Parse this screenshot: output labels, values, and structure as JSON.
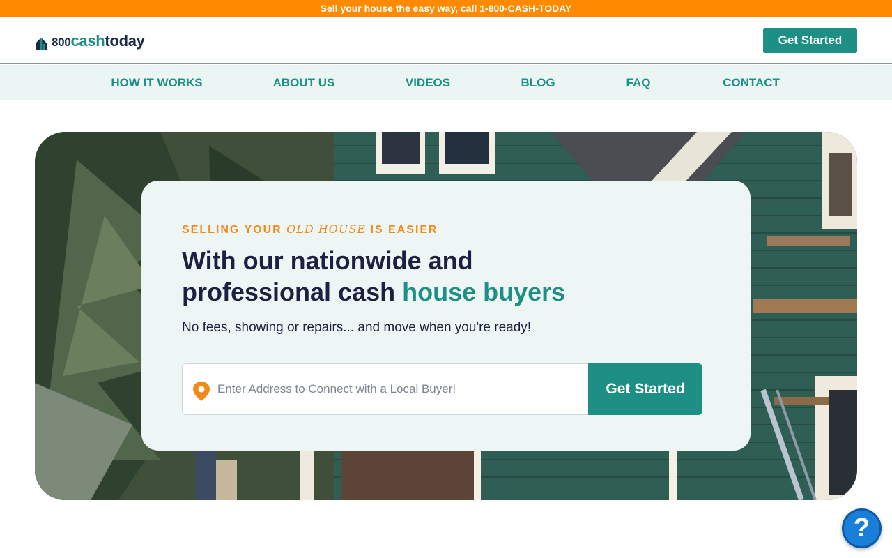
{
  "topbar": {
    "text": "Sell your house the easy way, call 1-800-CASH-TODAY"
  },
  "logo": {
    "part_800": "800",
    "part_cash": "cash",
    "part_today": "today"
  },
  "header": {
    "cta_label": "Get Started"
  },
  "nav": {
    "items": [
      {
        "label": "HOW IT WORKS"
      },
      {
        "label": "ABOUT US"
      },
      {
        "label": "VIDEOS"
      },
      {
        "label": "BLOG"
      },
      {
        "label": "FAQ"
      },
      {
        "label": "CONTACT"
      }
    ]
  },
  "hero": {
    "eyebrow_a": "SELLING YOUR ",
    "eyebrow_b": "OLD HOUSE",
    "eyebrow_c": " IS EASIER",
    "headline_line1": "With our nationwide and",
    "headline_line2": "professional cash ",
    "headline_accent": "house buyers",
    "subtitle": "No fees, showing or repairs... and move when you're ready!",
    "address_placeholder": "Enter Address to Connect with a Local Buyer!",
    "address_value": "",
    "cta_label": "Get Started"
  },
  "help_widget": {
    "symbol": "?"
  },
  "colors": {
    "accent_teal": "#1e8f84",
    "topbar_orange": "#ff8a00",
    "eyebrow_orange": "#f28a1a",
    "heading_navy": "#1b2140"
  },
  "icons": [
    "house-icon",
    "location-pin-icon",
    "help-icon"
  ]
}
